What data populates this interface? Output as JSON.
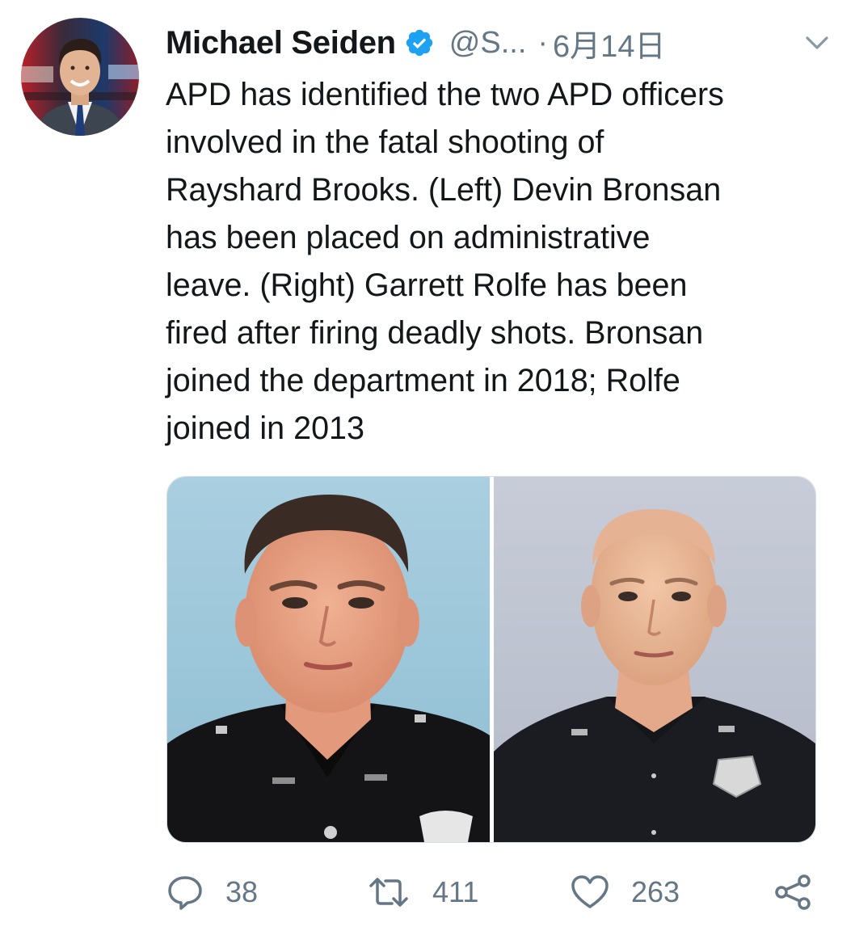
{
  "tweet": {
    "author_name": "Michael Seiden",
    "handle": "@S...",
    "separator": "·",
    "date": "6月14日",
    "text_lines": [
      "APD has identified the two APD officers",
      "involved in the fatal shooting of",
      "Rayshard Brooks. (Left)  Devin Bronsan",
      "has been placed on administrative",
      "leave. (Right) Garrett Rolfe has been",
      "fired after firing deadly shots. Bronsan",
      "joined the department in 2018; Rolfe",
      "joined in 2013"
    ]
  },
  "icons": {
    "verified": "verified-badge-icon",
    "caret": "chevron-down-icon",
    "reply": "reply-bubble-icon",
    "retweet": "retweet-icon",
    "like": "heart-icon",
    "share": "share-icon"
  },
  "actions": {
    "reply_count": "38",
    "retweet_count": "411",
    "like_count": "263"
  },
  "colors": {
    "text": "#14171a",
    "muted": "#657786",
    "verified_blue": "#1da1f2",
    "icon_gray": "#657786"
  }
}
